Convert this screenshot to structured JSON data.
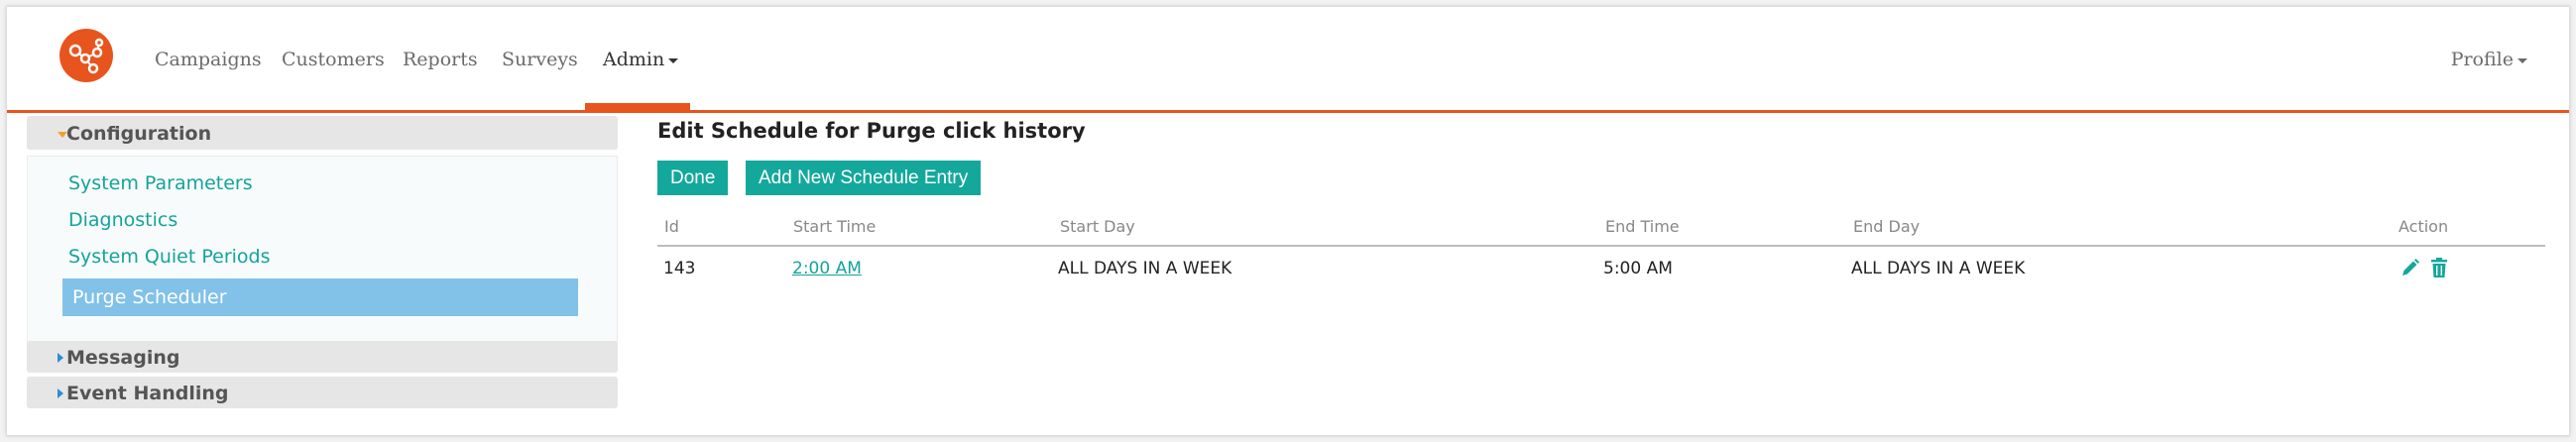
{
  "navbar": {
    "logo_icon": "network-nodes-logo",
    "items": [
      {
        "label": "Campaigns"
      },
      {
        "label": "Customers"
      },
      {
        "label": "Reports"
      },
      {
        "label": "Surveys"
      },
      {
        "label": "Admin"
      }
    ],
    "active_item": "Admin",
    "profile_label": "Profile",
    "accent_color": "#e8541e"
  },
  "sidebar": {
    "sections": [
      {
        "title": "Configuration",
        "expanded": true,
        "items": [
          {
            "label": "System Parameters"
          },
          {
            "label": "Diagnostics"
          },
          {
            "label": "System Quiet Periods"
          },
          {
            "label": "Purge Scheduler",
            "active": true
          }
        ]
      },
      {
        "title": "Messaging",
        "expanded": false
      },
      {
        "title": "Event Handling",
        "expanded": false
      }
    ]
  },
  "main": {
    "title": "Edit Schedule for Purge click history",
    "buttons": {
      "done": "Done",
      "add_entry": "Add New Schedule Entry"
    },
    "table": {
      "columns": [
        "Id",
        "Start Time",
        "Start Day",
        "End Time",
        "End Day",
        "Action"
      ],
      "rows": [
        {
          "id": "143",
          "start_time": "2:00 AM",
          "start_day": "ALL DAYS IN A WEEK",
          "end_time": "5:00 AM",
          "end_day": "ALL DAYS IN A WEEK",
          "actions": [
            "pencil-icon",
            "trash-icon"
          ]
        }
      ]
    }
  },
  "colors": {
    "teal": "#14a89c",
    "active_sidebar": "#82c1e8"
  }
}
